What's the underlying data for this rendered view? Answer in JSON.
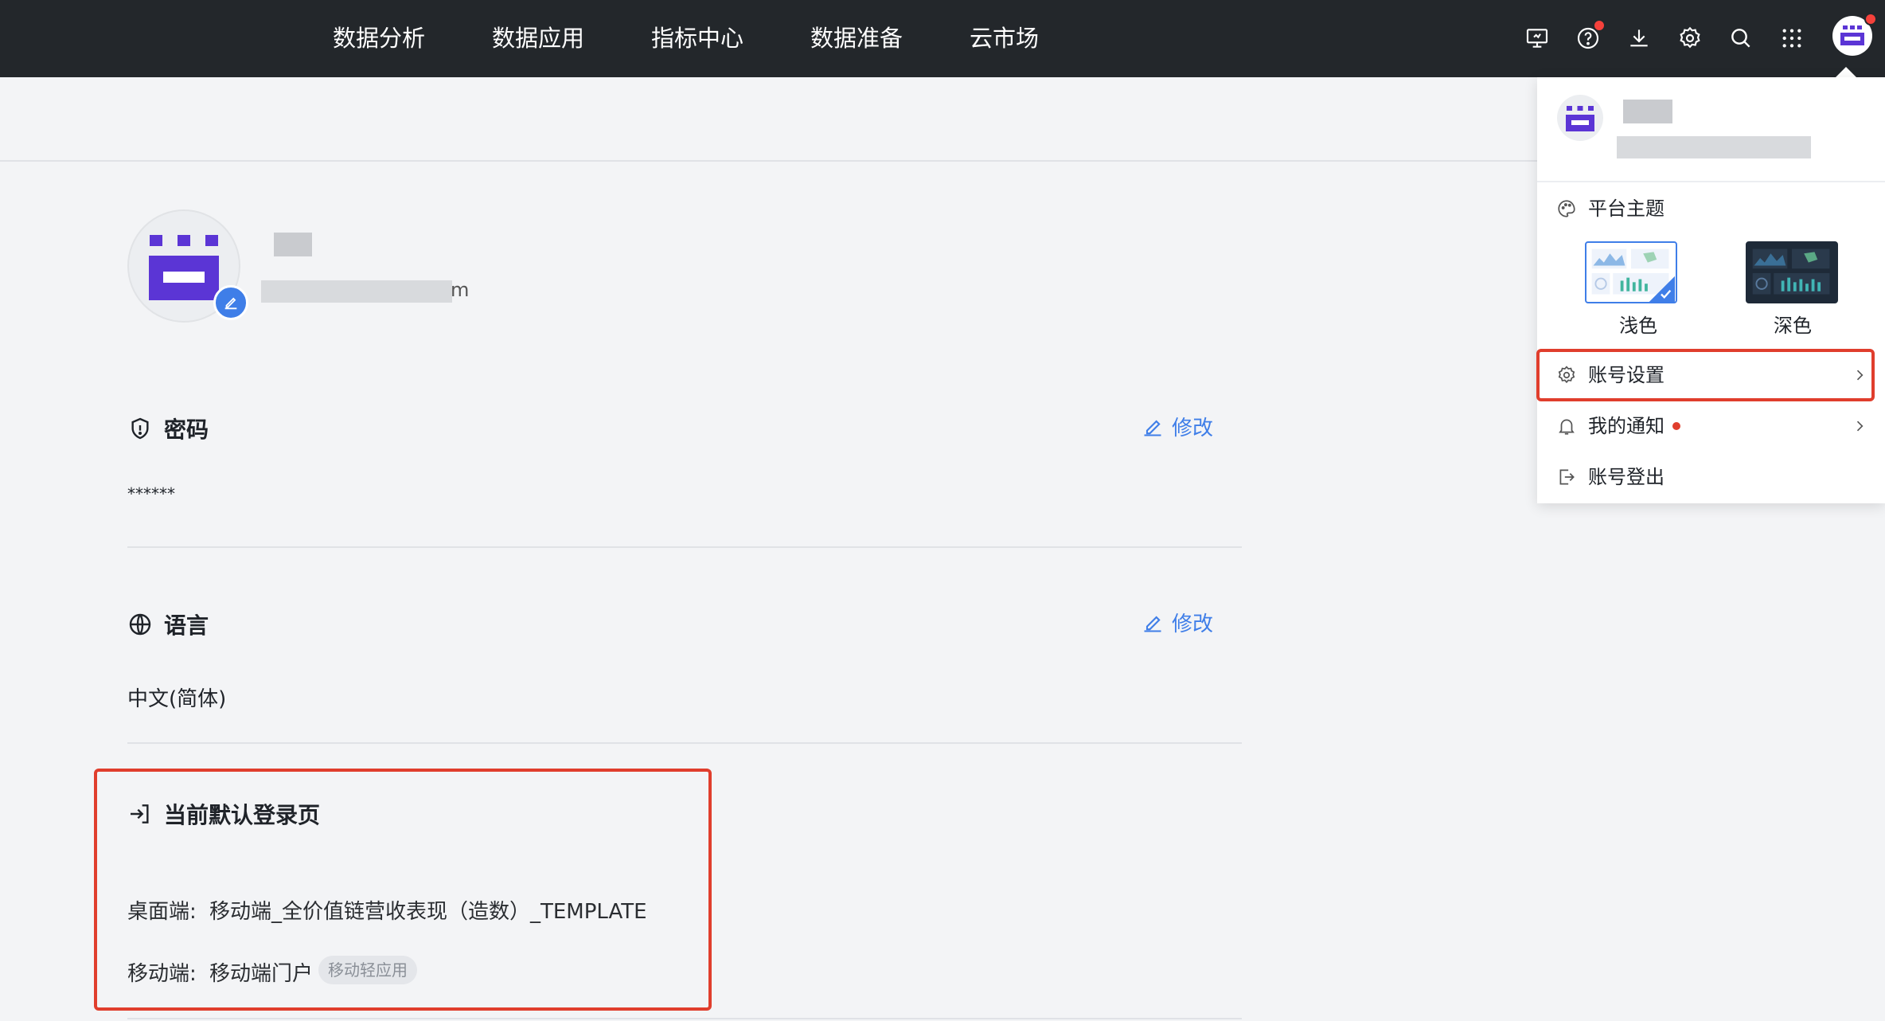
{
  "nav": {
    "items": [
      {
        "label": "数据分析"
      },
      {
        "label": "数据应用"
      },
      {
        "label": "指标中心"
      },
      {
        "label": "数据准备"
      },
      {
        "label": "云市场"
      }
    ]
  },
  "top_icons": [
    "monitor-icon",
    "help-icon",
    "download-icon",
    "gear-icon",
    "search-icon",
    "apps-grid-icon",
    "avatar"
  ],
  "profile": {
    "email_suffix": "m"
  },
  "password": {
    "title": "密码",
    "value": "******",
    "edit_label": "修改"
  },
  "language": {
    "title": "语言",
    "value": "中文(简体)",
    "edit_label": "修改"
  },
  "default_login": {
    "title": "当前默认登录页",
    "desktop_label": "桌面端:",
    "desktop_value": "移动端_全价值链营收表现（造数）_TEMPLATE",
    "mobile_label": "移动端:",
    "mobile_value": "移动端门户",
    "mobile_tag": "移动轻应用"
  },
  "panel": {
    "theme_title": "平台主题",
    "themes": [
      {
        "label": "浅色",
        "selected": true
      },
      {
        "label": "深色",
        "selected": false
      }
    ],
    "menu": [
      {
        "label": "账号设置",
        "has_arrow": true
      },
      {
        "label": "我的通知",
        "has_arrow": true,
        "has_dot": true
      },
      {
        "label": "账号登出",
        "has_arrow": false
      }
    ]
  },
  "colors": {
    "accent": "#3f7ee8",
    "brand_purple": "#5b35d5",
    "highlight_red": "#e03e2d",
    "topbar": "#23272b"
  }
}
